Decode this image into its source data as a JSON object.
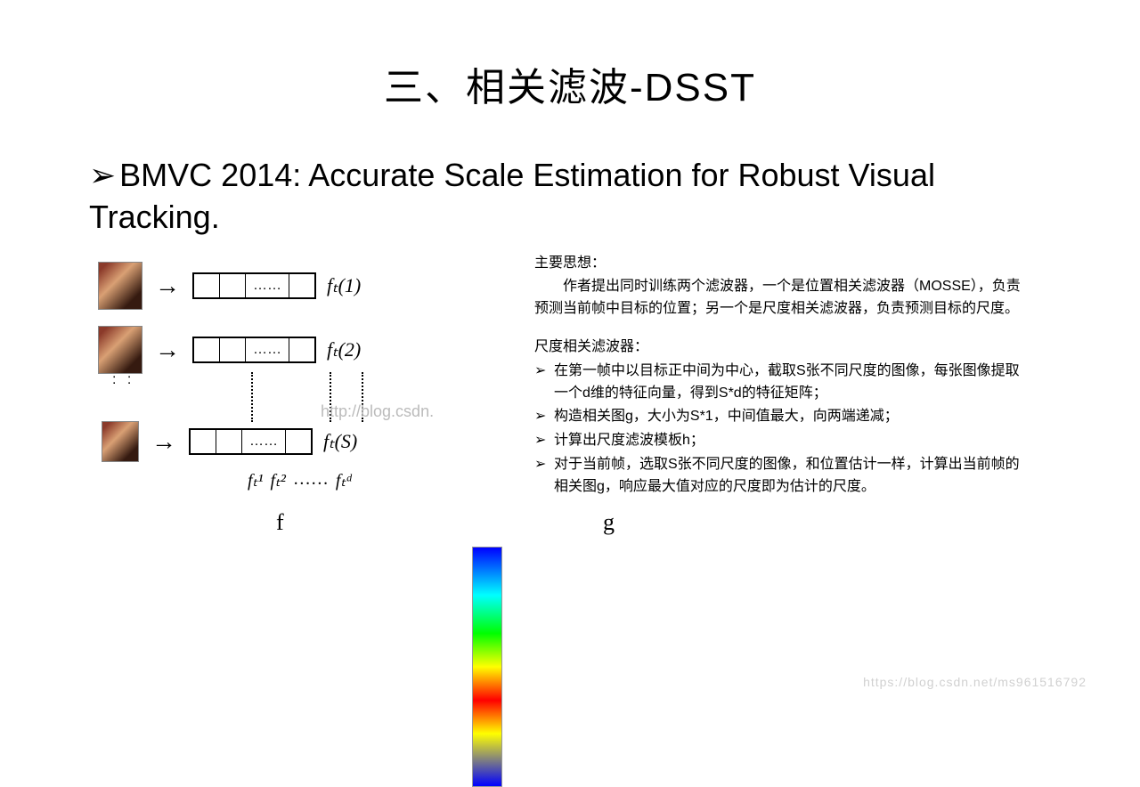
{
  "title": "三、相关滤波-DSST",
  "bullet": "BMVC 2014: Accurate Scale Estimation for Robust Visual Tracking.",
  "diagram": {
    "ftlabels": [
      "fₜ(1)",
      "fₜ(2)",
      "fₜ(S)"
    ],
    "axis": {
      "a1": "fₜ¹",
      "a2": "fₜ²",
      "dots": "……",
      "ad": "fₜᵈ"
    },
    "f": "f",
    "g": "g",
    "watermark": "http://blog.csdn."
  },
  "right": {
    "head1": "主要思想：",
    "body1": "作者提出同时训练两个滤波器，一个是位置相关滤波器（MOSSE），负责预测当前帧中目标的位置；另一个是尺度相关滤波器，负责预测目标的尺度。",
    "head2": "尺度相关滤波器：",
    "items": [
      "在第一帧中以目标正中间为中心，截取S张不同尺度的图像，每张图像提取一个d维的特征向量，得到S*d的特征矩阵；",
      "构造相关图g，大小为S*1，中间值最大，向两端递减；",
      "计算出尺度滤波模板h；",
      "对于当前帧，选取S张不同尺度的图像，和位置估计一样，计算出当前帧的相关图g，响应最大值对应的尺度即为估计的尺度。"
    ]
  },
  "footer": "https://blog.csdn.net/ms961516792"
}
